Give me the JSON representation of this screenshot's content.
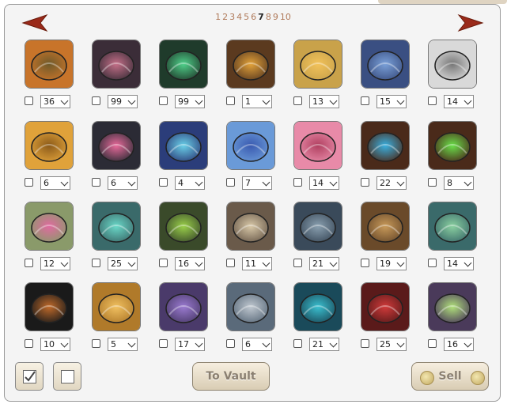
{
  "pagination": {
    "pages": [
      "1",
      "2",
      "3",
      "4",
      "5",
      "6",
      "7",
      "8",
      "9",
      "10"
    ],
    "current": "7"
  },
  "icons": {
    "prev": "arrow-left-icon",
    "next": "arrow-right-icon"
  },
  "items": [
    {
      "name": "autumn-leaves-icon",
      "qty": "36",
      "c1": "#c8742a",
      "c2": "#6f5a2a"
    },
    {
      "name": "dark-tail-ribbon-icon",
      "qty": "99",
      "c1": "#3b2d38",
      "c2": "#c46f88"
    },
    {
      "name": "green-ribbon-icon",
      "qty": "99",
      "c1": "#1f3b2b",
      "c2": "#4fd08a"
    },
    {
      "name": "tortoise-shell-icon",
      "qty": "1",
      "c1": "#5b3a1f",
      "c2": "#e2a23a"
    },
    {
      "name": "gold-bar-icon",
      "qty": "13",
      "c1": "#c9a24a",
      "c2": "#f2c25a"
    },
    {
      "name": "blue-bar-icon",
      "qty": "15",
      "c1": "#3a4f82",
      "c2": "#7aa0d8"
    },
    {
      "name": "grey-wings-icon",
      "qty": "14",
      "c1": "#d9d9d9",
      "c2": "#777777"
    },
    {
      "name": "golden-leaves-icon",
      "qty": "6",
      "c1": "#e0a23a",
      "c2": "#8b5a1a"
    },
    {
      "name": "black-swirl-tail-icon",
      "qty": "6",
      "c1": "#2b2b35",
      "c2": "#e86a9a"
    },
    {
      "name": "blue-swirl-tail-icon",
      "qty": "4",
      "c1": "#2b3d7a",
      "c2": "#6ad0e8"
    },
    {
      "name": "blue-feathers-icon",
      "qty": "7",
      "c1": "#6a9ad8",
      "c2": "#3a5ab0"
    },
    {
      "name": "pink-feathers-icon",
      "qty": "14",
      "c1": "#e88aa8",
      "c2": "#b04060"
    },
    {
      "name": "blue-potion-icon",
      "qty": "22",
      "c1": "#4a2a1a",
      "c2": "#3ab0e0"
    },
    {
      "name": "green-potion-icon",
      "qty": "8",
      "c1": "#4a2a1a",
      "c2": "#6ae04a"
    },
    {
      "name": "pink-coral-horns-icon",
      "qty": "12",
      "c1": "#8a9a6a",
      "c2": "#e06aa0"
    },
    {
      "name": "teal-coral-horns-icon",
      "qty": "25",
      "c1": "#3a6a6a",
      "c2": "#6ad8c8"
    },
    {
      "name": "green-stone-icon",
      "qty": "16",
      "c1": "#3a4a2a",
      "c2": "#9ad04a"
    },
    {
      "name": "brown-stone-icon",
      "qty": "11",
      "c1": "#6a5a4a",
      "c2": "#d8c8a8"
    },
    {
      "name": "grey-bracers-icon",
      "qty": "21",
      "c1": "#3a4a5a",
      "c2": "#8aa0b0"
    },
    {
      "name": "bronze-bracers-icon",
      "qty": "19",
      "c1": "#6a4a2a",
      "c2": "#c89a5a"
    },
    {
      "name": "green-armor-icon",
      "qty": "14",
      "c1": "#3a6a6a",
      "c2": "#8ad0a0"
    },
    {
      "name": "black-horn-helm-icon",
      "qty": "10",
      "c1": "#1a1a1a",
      "c2": "#c06a2a"
    },
    {
      "name": "gold-horn-helm-icon",
      "qty": "5",
      "c1": "#b07a2a",
      "c2": "#f0c060"
    },
    {
      "name": "purple-mech-helm-icon",
      "qty": "17",
      "c1": "#4a3a6a",
      "c2": "#9a7ad0"
    },
    {
      "name": "silver-mech-helm-icon",
      "qty": "6",
      "c1": "#5a6a7a",
      "c2": "#c0c8d0"
    },
    {
      "name": "teal-mech-armor-icon",
      "qty": "21",
      "c1": "#1a4a5a",
      "c2": "#3ac0d0"
    },
    {
      "name": "red-mech-armor-icon",
      "qty": "25",
      "c1": "#5a1a1a",
      "c2": "#d03a3a"
    },
    {
      "name": "green-crystal-icon",
      "qty": "16",
      "c1": "#4a3a5a",
      "c2": "#b0e07a"
    }
  ],
  "buttons": {
    "vault": "To Vault",
    "sell": "Sell"
  }
}
